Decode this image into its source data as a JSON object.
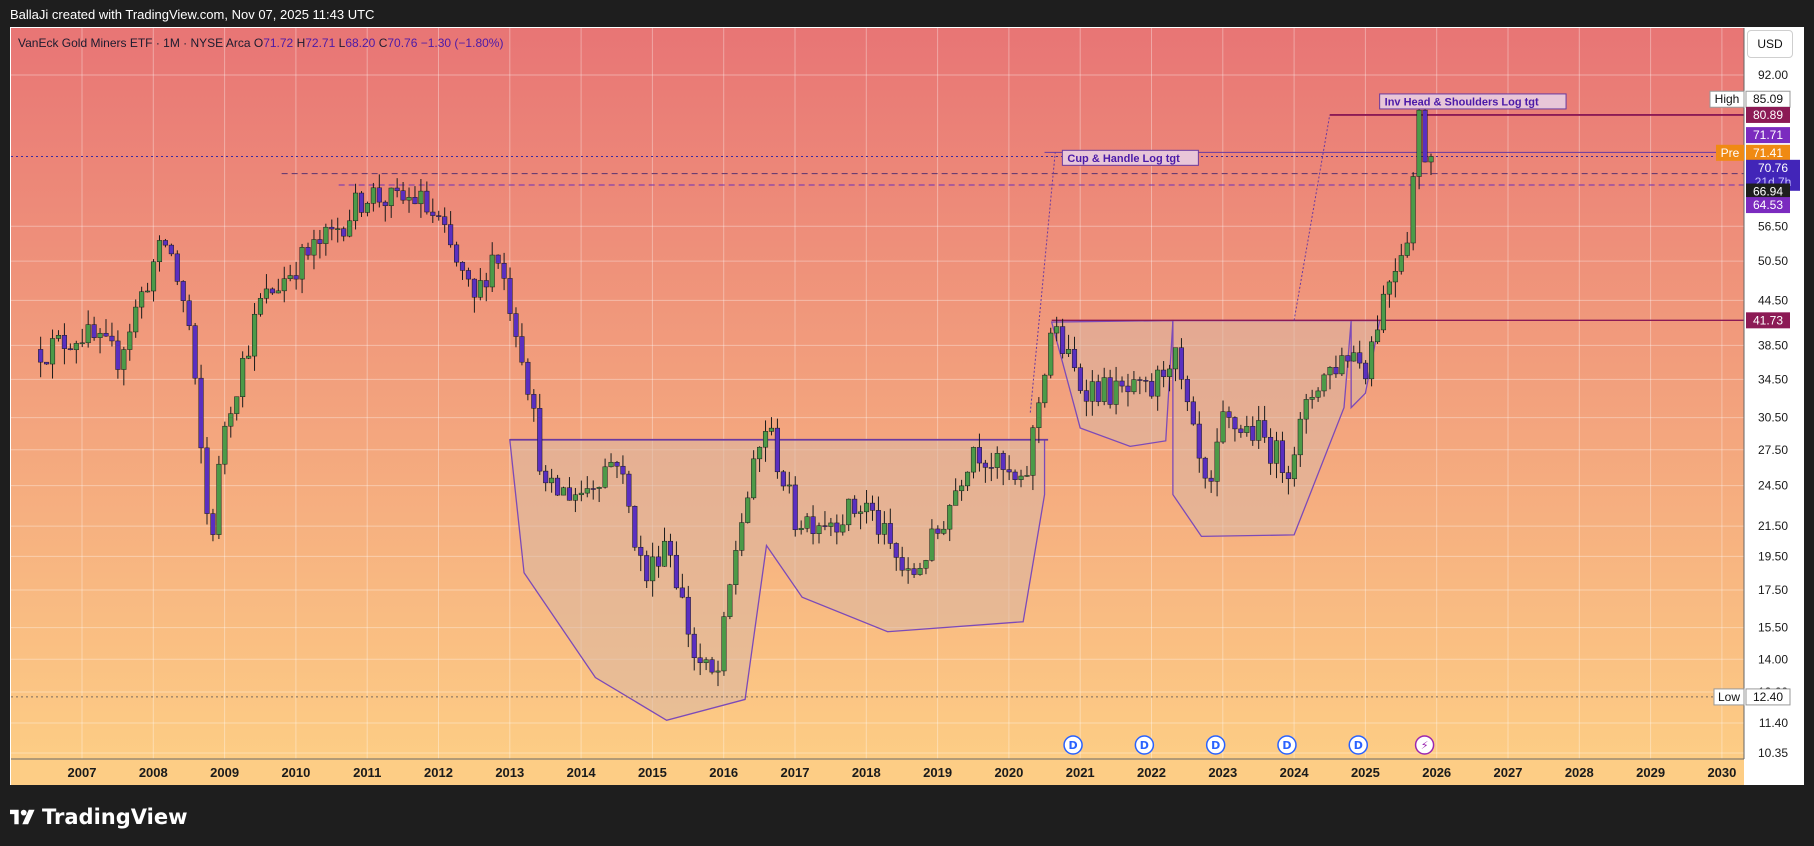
{
  "caption": "BallaJi created with TradingView.com, Nov 07, 2025 11:43 UTC",
  "brand": "TradingView",
  "currency_button": "USD",
  "legend": {
    "symbol": "VanEck Gold Miners ETF · 1M · NYSE Arca",
    "o_label": "O",
    "o": "71.72",
    "h_label": "H",
    "h": "72.71",
    "l_label": "L",
    "l": "68.20",
    "c_label": "C",
    "c": "70.76",
    "change": "−1.30 (−1.80%)"
  },
  "colors": {
    "bg_top": "#e87575",
    "bg_bottom": "#fdcd85",
    "bull": "#4c9a48",
    "bear": "#5a2fc0",
    "pattern": "#7c4ab8",
    "pattern_fill": "#d8b6a4",
    "neckline": "#8c1a55",
    "pre": "#f08a13"
  },
  "annotations": {
    "cup_handle": "Cup & Handle Log tgt",
    "inv_hs": "Inv Head & Shoulders Log tgt"
  },
  "dividend_icons": [
    "D",
    "D",
    "D",
    "D",
    "D",
    "⚡"
  ],
  "price_tags": {
    "high_label": "High",
    "high": "85.09",
    "t1": "80.89",
    "t2": "71.71",
    "pre_label": "Pre",
    "pre": "71.41",
    "last": "70.76",
    "countdown": "21d 7h",
    "t3": "66.94",
    "t4": "64.53",
    "neck": "41.73",
    "low_label": "Low",
    "low": "12.40"
  },
  "chart_data": {
    "type": "candlestick",
    "title": "VanEck Gold Miners ETF · 1M · NYSE Arca",
    "y_scale": "log",
    "ylim": [
      10.35,
      92
    ],
    "y_ticks": [
      "92.00",
      "56.50",
      "50.50",
      "44.50",
      "38.50",
      "34.50",
      "30.50",
      "27.50",
      "24.50",
      "21.50",
      "19.50",
      "17.50",
      "15.50",
      "14.00",
      "12.60",
      "11.40",
      "10.35"
    ],
    "x_ticks": [
      "2007",
      "2008",
      "2009",
      "2010",
      "2011",
      "2012",
      "2013",
      "2014",
      "2015",
      "2016",
      "2017",
      "2018",
      "2019",
      "2020",
      "2021",
      "2022",
      "2023",
      "2024",
      "2025",
      "2026",
      "2027",
      "2028",
      "2029",
      "2030"
    ],
    "x_range": [
      "2006-03",
      "2030-01"
    ],
    "grid": true,
    "horizontal_levels": [
      {
        "value": 41.73,
        "label": "neckline"
      },
      {
        "value": 28.4,
        "label": "cup rim"
      },
      {
        "value": 66.94,
        "style": "dashed"
      },
      {
        "value": 64.53,
        "style": "dashed"
      },
      {
        "value": 80.89
      },
      {
        "value": 71.71
      },
      {
        "value": 12.4,
        "style": "dotted"
      }
    ],
    "series": [
      {
        "x": 2006.5,
        "y": 38
      },
      {
        "x": 2007.0,
        "y": 40
      },
      {
        "x": 2007.5,
        "y": 37
      },
      {
        "x": 2008.0,
        "y": 50
      },
      {
        "x": 2008.2,
        "y": 54
      },
      {
        "x": 2008.5,
        "y": 41
      },
      {
        "x": 2008.8,
        "y": 20
      },
      {
        "x": 2009.0,
        "y": 30
      },
      {
        "x": 2009.5,
        "y": 44
      },
      {
        "x": 2010.0,
        "y": 50
      },
      {
        "x": 2010.5,
        "y": 55
      },
      {
        "x": 2011.0,
        "y": 63
      },
      {
        "x": 2011.4,
        "y": 61
      },
      {
        "x": 2011.7,
        "y": 62
      },
      {
        "x": 2012.0,
        "y": 57
      },
      {
        "x": 2012.5,
        "y": 44
      },
      {
        "x": 2012.8,
        "y": 53
      },
      {
        "x": 2013.2,
        "y": 37
      },
      {
        "x": 2013.5,
        "y": 24
      },
      {
        "x": 2014.0,
        "y": 24
      },
      {
        "x": 2014.5,
        "y": 27
      },
      {
        "x": 2014.9,
        "y": 18
      },
      {
        "x": 2015.2,
        "y": 21
      },
      {
        "x": 2015.6,
        "y": 14
      },
      {
        "x": 2015.9,
        "y": 13
      },
      {
        "x": 2016.2,
        "y": 21
      },
      {
        "x": 2016.6,
        "y": 30
      },
      {
        "x": 2017.0,
        "y": 22
      },
      {
        "x": 2017.5,
        "y": 22
      },
      {
        "x": 2018.0,
        "y": 23
      },
      {
        "x": 2018.6,
        "y": 18
      },
      {
        "x": 2019.0,
        "y": 21
      },
      {
        "x": 2019.5,
        "y": 28
      },
      {
        "x": 2020.2,
        "y": 24
      },
      {
        "x": 2020.6,
        "y": 41
      },
      {
        "x": 2021.0,
        "y": 34
      },
      {
        "x": 2021.5,
        "y": 33
      },
      {
        "x": 2022.0,
        "y": 33
      },
      {
        "x": 2022.3,
        "y": 38
      },
      {
        "x": 2022.8,
        "y": 23
      },
      {
        "x": 2023.0,
        "y": 30
      },
      {
        "x": 2023.5,
        "y": 29
      },
      {
        "x": 2023.9,
        "y": 26
      },
      {
        "x": 2024.3,
        "y": 34
      },
      {
        "x": 2024.8,
        "y": 38
      },
      {
        "x": 2025.0,
        "y": 36
      },
      {
        "x": 2025.3,
        "y": 47
      },
      {
        "x": 2025.6,
        "y": 56
      },
      {
        "x": 2025.75,
        "y": 80.89
      },
      {
        "x": 2025.85,
        "y": 70.76
      }
    ]
  }
}
